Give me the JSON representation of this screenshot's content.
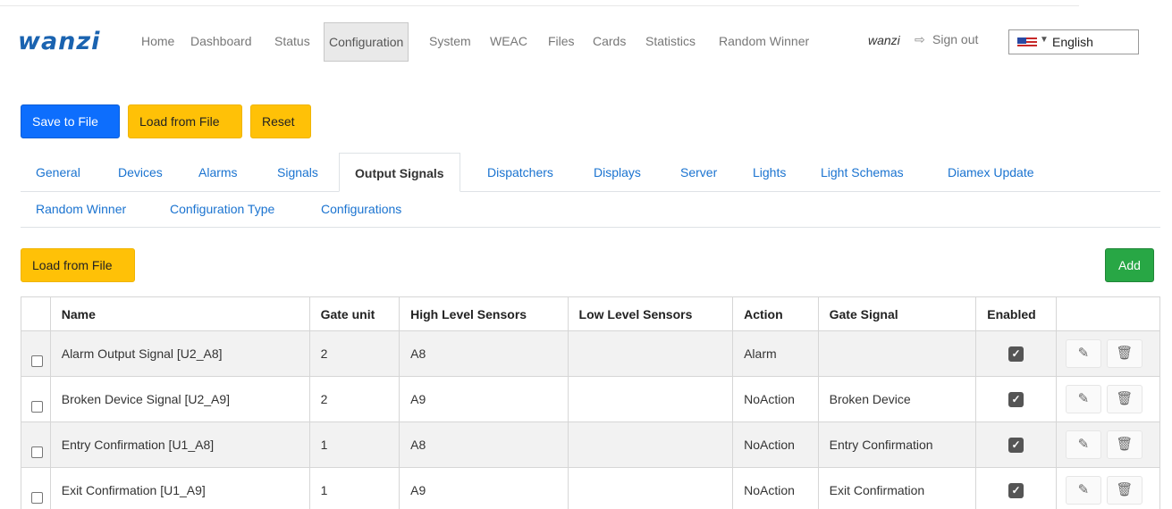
{
  "nav": {
    "logo": "wanzi",
    "items": [
      "Home",
      "Dashboard",
      "Status",
      "Configuration",
      "System",
      "WEAC",
      "Files",
      "Cards",
      "Statistics",
      "Random Winner"
    ],
    "active": "Configuration",
    "user": "wanzi",
    "signout_label": "Sign out",
    "language": "English"
  },
  "toolbar": {
    "save_label": "Save to File",
    "load_label": "Load from File",
    "reset_label": "Reset"
  },
  "tabs": {
    "row1": [
      "General",
      "Devices",
      "Alarms",
      "Signals",
      "Output Signals",
      "Dispatchers",
      "Displays",
      "Server",
      "Lights",
      "Light Schemas",
      "Diamex Update"
    ],
    "row2": [
      "Random Winner",
      "Configuration Type",
      "Configurations"
    ],
    "active": "Output Signals"
  },
  "section": {
    "load_label": "Load from File",
    "add_label": "Add"
  },
  "table": {
    "columns": [
      "Name",
      "Gate unit",
      "High Level Sensors",
      "Low Level Sensors",
      "Action",
      "Gate Signal",
      "Enabled"
    ],
    "rows": [
      {
        "name": "Alarm Output Signal [U2_A8]",
        "gate_unit": "2",
        "high": "A8",
        "low": "",
        "action": "Alarm",
        "gate_signal": "",
        "enabled": true
      },
      {
        "name": "Broken Device Signal [U2_A9]",
        "gate_unit": "2",
        "high": "A9",
        "low": "",
        "action": "NoAction",
        "gate_signal": "Broken Device",
        "enabled": true
      },
      {
        "name": "Entry Confirmation [U1_A8]",
        "gate_unit": "1",
        "high": "A8",
        "low": "",
        "action": "NoAction",
        "gate_signal": "Entry Confirmation",
        "enabled": true
      },
      {
        "name": "Exit Confirmation [U1_A9]",
        "gate_unit": "1",
        "high": "A9",
        "low": "",
        "action": "NoAction",
        "gate_signal": "Exit Confirmation",
        "enabled": true
      }
    ]
  },
  "colors": {
    "primary": "#0d6efd",
    "warning": "#ffc107",
    "success": "#28a745",
    "link": "#1a73d0",
    "logo": "#1a63b0"
  },
  "icons": {
    "signout": "sign-out-icon",
    "edit": "edit-icon",
    "delete": "trash-icon",
    "enabled": "checked-icon"
  }
}
